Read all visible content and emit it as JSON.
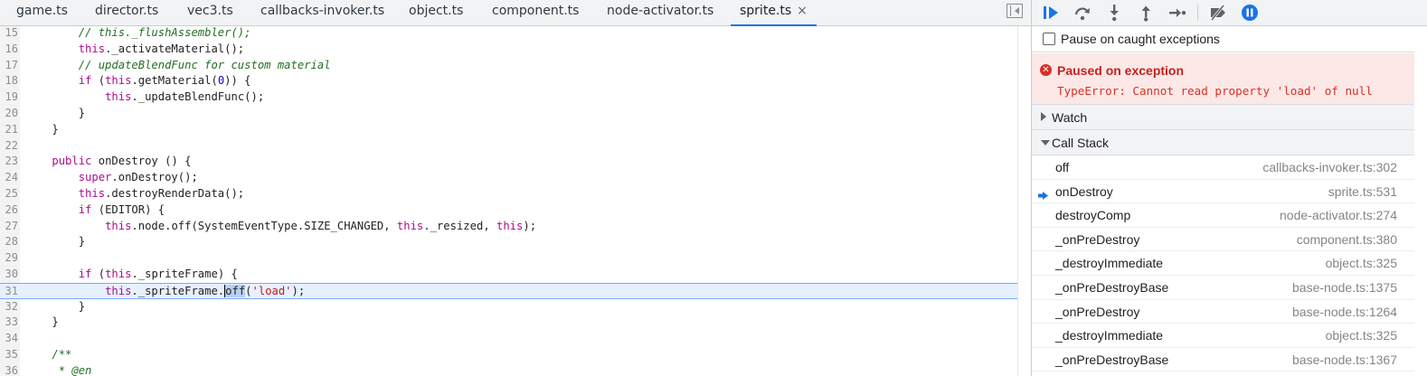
{
  "tabs": [
    {
      "label": "game.ts"
    },
    {
      "label": "director.ts"
    },
    {
      "label": "vec3.ts"
    },
    {
      "label": "callbacks-invoker.ts"
    },
    {
      "label": "object.ts"
    },
    {
      "label": "component.ts"
    },
    {
      "label": "node-activator.ts"
    },
    {
      "label": "sprite.ts",
      "close": "×"
    }
  ],
  "code_lines": [
    {
      "num": "15",
      "html": "        <span class=\"c-com\">// this._flushAssembler();</span>"
    },
    {
      "num": "16",
      "html": "        <span class=\"c-kw\">this</span>._activateMaterial();"
    },
    {
      "num": "17",
      "html": "        <span class=\"c-com\">// updateBlendFunc for custom material</span>"
    },
    {
      "num": "18",
      "html": "        <span class=\"c-kw\">if</span> (<span class=\"c-kw\">this</span>.getMaterial(<span class=\"c-num\">0</span>)) {"
    },
    {
      "num": "19",
      "html": "            <span class=\"c-kw\">this</span>._updateBlendFunc();"
    },
    {
      "num": "20",
      "html": "        }"
    },
    {
      "num": "21",
      "html": "    }"
    },
    {
      "num": "22",
      "html": ""
    },
    {
      "num": "23",
      "html": "    <span class=\"c-kw\">public</span> onDestroy () {"
    },
    {
      "num": "24",
      "html": "        <span class=\"c-kw\">super</span>.onDestroy();"
    },
    {
      "num": "25",
      "html": "        <span class=\"c-kw\">this</span>.destroyRenderData();"
    },
    {
      "num": "26",
      "html": "        <span class=\"c-kw\">if</span> (EDITOR) {"
    },
    {
      "num": "27",
      "html": "            <span class=\"c-kw\">this</span>.node.off(SystemEventType.SIZE_CHANGED, <span class=\"c-kw\">this</span>._resized, <span class=\"c-kw\">this</span>);"
    },
    {
      "num": "28",
      "html": "        }"
    },
    {
      "num": "29",
      "html": ""
    },
    {
      "num": "30",
      "html": "        <span class=\"c-kw\">if</span> (<span class=\"c-kw\">this</span>._spriteFrame) {"
    },
    {
      "num": "31",
      "html": "            <span class=\"c-kw\">this</span>._spriteFrame.<span class=\"cursor\"></span><span class=\"sel\">off</span>(<span class=\"c-str\">'load'</span>);",
      "current": true
    },
    {
      "num": "32",
      "html": "        }"
    },
    {
      "num": "33",
      "html": "    }"
    },
    {
      "num": "34",
      "html": ""
    },
    {
      "num": "35",
      "html": "    <span class=\"c-com\">/**</span>"
    },
    {
      "num": "36",
      "html": "     <span class=\"c-com\">* @en</span>"
    }
  ],
  "debugger": {
    "pause_caught_label": "Pause on caught exceptions",
    "paused_title": "Paused on exception",
    "paused_detail": "TypeError: Cannot read property 'load' of null",
    "error_icon": "✕",
    "watch_label": "Watch",
    "callstack_label": "Call Stack",
    "frames": [
      {
        "fn": "off",
        "loc": "callbacks-invoker.ts:302",
        "current": false
      },
      {
        "fn": "onDestroy",
        "loc": "sprite.ts:531",
        "current": true
      },
      {
        "fn": "destroyComp",
        "loc": "node-activator.ts:274",
        "current": false
      },
      {
        "fn": "_onPreDestroy",
        "loc": "component.ts:380",
        "current": false
      },
      {
        "fn": "_destroyImmediate",
        "loc": "object.ts:325",
        "current": false
      },
      {
        "fn": "_onPreDestroyBase",
        "loc": "base-node.ts:1375",
        "current": false
      },
      {
        "fn": "_onPreDestroy",
        "loc": "base-node.ts:1264",
        "current": false
      },
      {
        "fn": "_destroyImmediate",
        "loc": "object.ts:325",
        "current": false
      },
      {
        "fn": "_onPreDestroyBase",
        "loc": "base-node.ts:1367",
        "current": false
      }
    ]
  },
  "toolbar_icons": [
    "resume-icon",
    "step-over-icon",
    "step-into-icon",
    "step-out-icon",
    "step-icon",
    "deactivate-breakpoints-icon",
    "pause-on-exceptions-icon"
  ],
  "colors": {
    "accent": "#1a73e8",
    "error": "#d93025",
    "error_bg": "#fce8e6"
  }
}
